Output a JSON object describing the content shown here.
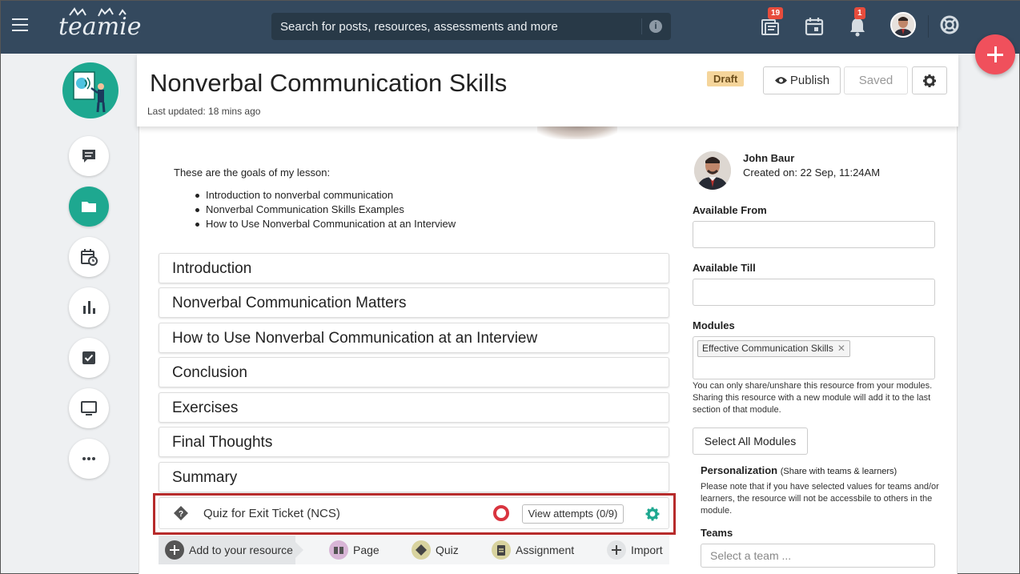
{
  "topbar": {
    "logo_text": "teamie",
    "search_placeholder": "Search for posts, resources, assessments and more",
    "badges": {
      "resources": "19",
      "notifications": "1"
    }
  },
  "icons": {
    "menu": "hamburger-icon",
    "search_info": "info-icon",
    "resources": "stack-icon",
    "calendar": "calendar-icon",
    "notifications": "bell-icon",
    "help": "lifebuoy-icon",
    "add": "plus-icon"
  },
  "rail": [
    "chat-icon",
    "folder-icon",
    "calendar-clock-icon",
    "bar-chart-icon",
    "checkbox-icon",
    "monitor-icon",
    "more-icon"
  ],
  "header": {
    "title": "Nonverbal Communication Skills",
    "last_updated": "Last updated: 18 mins ago",
    "status": "Draft",
    "publish_label": "Publish",
    "saved_label": "Saved"
  },
  "lesson": {
    "intro": "These are the goals of my lesson:",
    "goals": [
      "Introduction to nonverbal communication",
      "Nonverbal Communication Skills Examples",
      "How to Use Nonverbal Communication at an Interview"
    ],
    "sections": [
      "Introduction",
      "Nonverbal Communication Matters",
      "How to Use Nonverbal Communication at an Interview",
      "Conclusion",
      "Exercises",
      "Final Thoughts",
      "Summary"
    ],
    "quiz": {
      "title": "Quiz for Exit Ticket (NCS)",
      "attempts_label": "View attempts (0/9)"
    },
    "add_bar": {
      "add_label": "Add to your resource",
      "page": "Page",
      "quiz": "Quiz",
      "assignment": "Assignment",
      "import": "Import"
    }
  },
  "sidebar": {
    "author_name": "John Baur",
    "created_on": "Created on: 22 Sep, 11:24AM",
    "available_from_label": "Available From",
    "available_till_label": "Available Till",
    "modules_label": "Modules",
    "module_chip": "Effective Communication Skills",
    "modules_note": "You can only share/unshare this resource from your modules. Sharing this resource with a new module will add it to the last section of that module.",
    "select_all_label": "Select All Modules",
    "personalization_label": "Personalization",
    "personalization_sub": "(Share with teams & learners)",
    "personalization_note": "Please note that if you have selected values for teams and/or learners, the resource will not be accessbile to others in the module.",
    "teams_label": "Teams",
    "teams_placeholder": "Select a team ..."
  },
  "colors": {
    "topbar": "#34495e",
    "accent_green": "#1ea890",
    "fab_red": "#f0505c",
    "highlight_red": "#b72b2b",
    "draft_badge": "#f5d59b"
  }
}
